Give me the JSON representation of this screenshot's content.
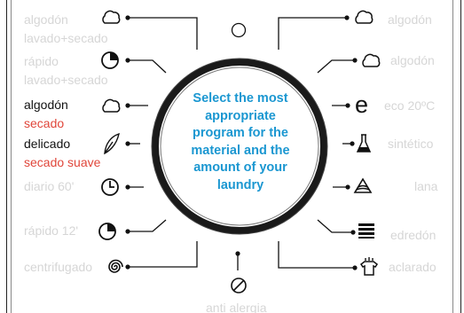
{
  "dial": {
    "center_text": "Select the most appropriate program for the material and the amount of your laundry"
  },
  "left_programs": [
    {
      "line1": "algodón",
      "line2": "lavado+secado",
      "icon": "cloud-icon"
    },
    {
      "line1": "rápido",
      "line2": "lavado+secado",
      "icon": "fast-clock-icon"
    },
    {
      "line1": "algodón",
      "line2": "secado",
      "icon": "cloud-icon"
    },
    {
      "line1": "delicado",
      "line2": "secado suave",
      "icon": "feather-icon"
    },
    {
      "line1": "diario 60'",
      "icon": "clock-icon"
    },
    {
      "line1": "rápido 12'",
      "icon": "fast-clock-icon"
    },
    {
      "line1": "centrifugado",
      "icon": "spiral-icon"
    }
  ],
  "right_programs": [
    {
      "label": "algodón",
      "icon": "cloud-icon"
    },
    {
      "label": "algodón",
      "icon": "cloud-icon"
    },
    {
      "label": "eco 20ºC",
      "icon": "eco-e-icon"
    },
    {
      "label": "sintético",
      "icon": "flask-icon"
    },
    {
      "label": "lana",
      "icon": "wool-icon"
    },
    {
      "label": "edredón",
      "icon": "duvet-icon"
    },
    {
      "label": "aclarado",
      "icon": "shirt-rinse-icon"
    }
  ],
  "top_position": {
    "icon": "off-circle-icon"
  },
  "bottom_program": {
    "label": "anti alergia",
    "icon": "slashed-circle-icon"
  },
  "colors": {
    "active_text": "#111111",
    "inactive_text": "#d6d6d6",
    "drying_text": "#e0463a",
    "dial_text": "#1b97d1"
  }
}
